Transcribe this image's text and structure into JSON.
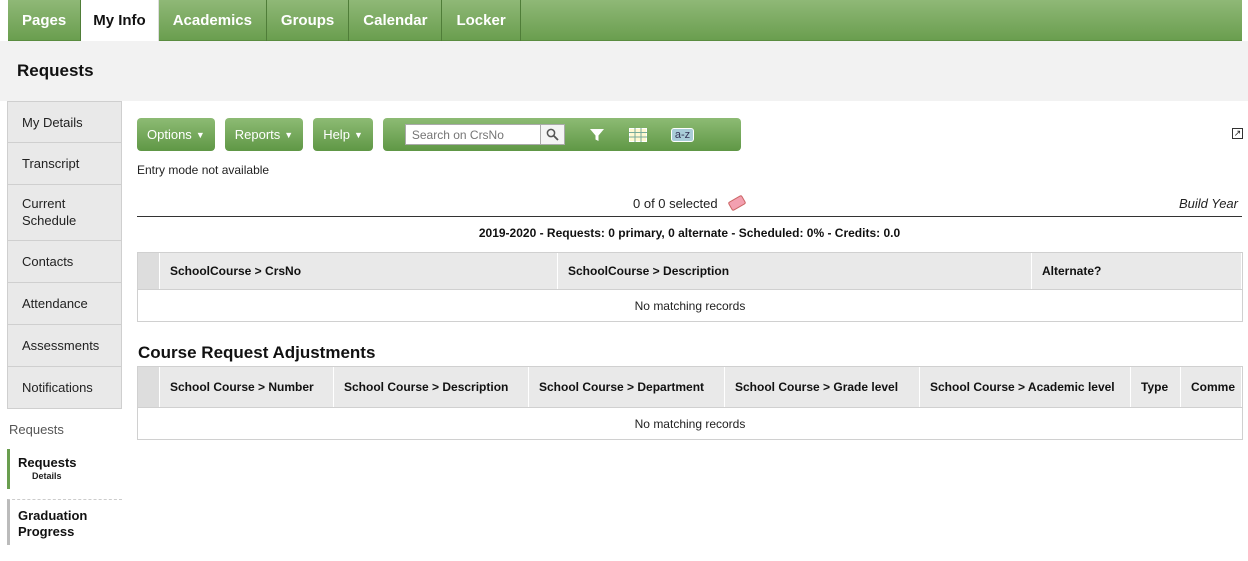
{
  "top_tabs": [
    "Pages",
    "My Info",
    "Academics",
    "Groups",
    "Calendar",
    "Locker"
  ],
  "active_tab": "My Info",
  "page_title": "Requests",
  "sidebar": {
    "items": [
      "My Details",
      "Transcript",
      "Current Schedule",
      "Contacts",
      "Attendance",
      "Assessments",
      "Notifications"
    ],
    "section_label": "Requests",
    "sub_active": {
      "label": "Requests",
      "sub": "Details"
    },
    "sub_other": "Graduation Progress"
  },
  "toolbar": {
    "options_label": "Options",
    "reports_label": "Reports",
    "help_label": "Help",
    "search_placeholder": "Search on CrsNo",
    "az_label": "a-z"
  },
  "entry_mode": "Entry mode not available",
  "selection": {
    "count_text": "0 of 0 selected",
    "build_year": "Build Year"
  },
  "summary": "2019-2020 - Requests: 0 primary, 0 alternate - Scheduled: 0% - Credits: 0.0",
  "requests_table": {
    "columns": [
      "SchoolCourse > CrsNo",
      "SchoolCourse > Description",
      "Alternate?"
    ],
    "empty_text": "No matching records"
  },
  "adjustments": {
    "title": "Course Request Adjustments",
    "columns": [
      "School Course > Number",
      "School Course > Description",
      "School Course > Department",
      "School Course > Grade level",
      "School Course > Academic level",
      "Type",
      "Comme"
    ],
    "empty_text": "No matching records"
  },
  "colors": {
    "accent_green": "#6a9e4f"
  }
}
